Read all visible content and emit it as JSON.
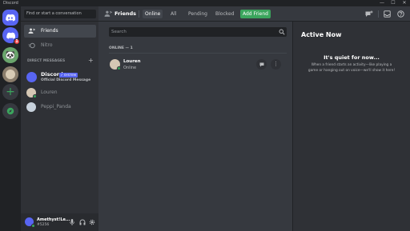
{
  "window": {
    "title": "Discord"
  },
  "sidebar": {
    "search_placeholder": "Find or start a conversation",
    "nav": [
      {
        "label": "Friends"
      },
      {
        "label": "Nitro"
      }
    ],
    "dm_header": "DIRECT MESSAGES",
    "dms": [
      {
        "name": "Discord",
        "badge": "✓ SYSTEM",
        "subtitle": "Official Discord Message"
      },
      {
        "name": "Louren"
      },
      {
        "name": "Peppi_Panda"
      }
    ]
  },
  "user": {
    "name": "Amethyst!Le...",
    "tag": "#5256"
  },
  "header": {
    "title": "Friends",
    "tabs": [
      {
        "label": "Online"
      },
      {
        "label": "All"
      },
      {
        "label": "Pending"
      },
      {
        "label": "Blocked"
      }
    ],
    "add_friend": "Add Friend"
  },
  "main": {
    "search_placeholder": "Search",
    "online_header": "ONLINE — 1",
    "friends": [
      {
        "name": "Louren",
        "status": "Online"
      }
    ]
  },
  "active": {
    "title": "Active Now",
    "empty_title": "It's quiet for now...",
    "empty_line1": "When a friend starts an activity—like playing a",
    "empty_line2": "game or hanging out on voice—we'll show it here!"
  },
  "guilds": {
    "notification_count": "1"
  },
  "colors": {
    "blurple": "#5865f2",
    "green": "#3ba55d",
    "red": "#ed4245"
  }
}
